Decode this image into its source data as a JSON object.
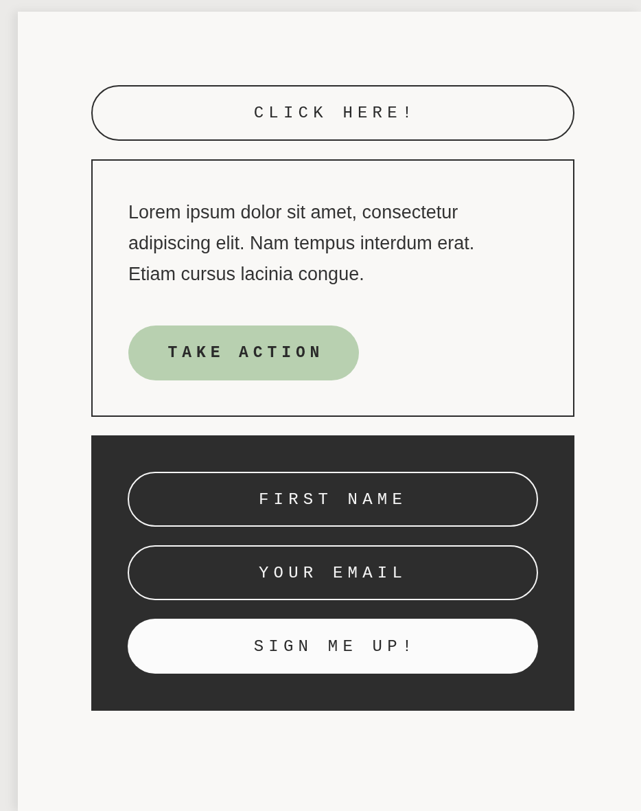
{
  "top_button": {
    "label": "CLICK HERE!"
  },
  "card": {
    "text": "Lorem ipsum dolor sit amet, consectetur adipiscing elit. Nam tempus interdum erat. Etiam cursus lacinia congue.",
    "button": "TAKE ACTION"
  },
  "signup": {
    "fields": [
      {
        "placeholder": "FIRST NAME"
      },
      {
        "placeholder": "YOUR EMAIL"
      }
    ],
    "button": "SIGN ME UP!"
  }
}
